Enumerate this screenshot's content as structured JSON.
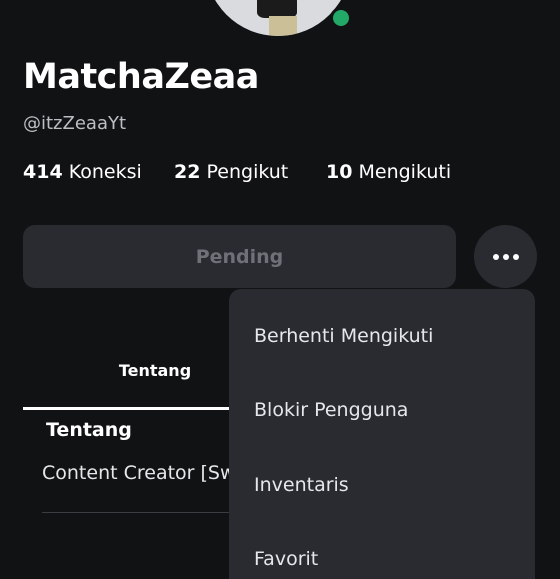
{
  "profile": {
    "display_name": "MatchaZeaa",
    "username": "@itzZeaaYt",
    "online_status": "online"
  },
  "stats": {
    "connections_count": "414",
    "connections_label": "Koneksi",
    "followers_count": "22",
    "followers_label": "Pengikut",
    "following_count": "10",
    "following_label": "Mengikuti"
  },
  "actions": {
    "pending_label": "Pending",
    "more_icon": "more-horizontal-icon"
  },
  "tabs": [
    {
      "label": "Tentang"
    }
  ],
  "about": {
    "title": "Tentang",
    "text": "Content Creator [Sw"
  },
  "menu": {
    "items": [
      {
        "label": "Berhenti Mengikuti"
      },
      {
        "label": "Blokir Pengguna"
      },
      {
        "label": "Inventaris"
      },
      {
        "label": "Favorit"
      }
    ]
  },
  "colors": {
    "background": "#111214",
    "surface": "#2a2b30",
    "online": "#22a867",
    "muted_text": "#6f7178"
  }
}
